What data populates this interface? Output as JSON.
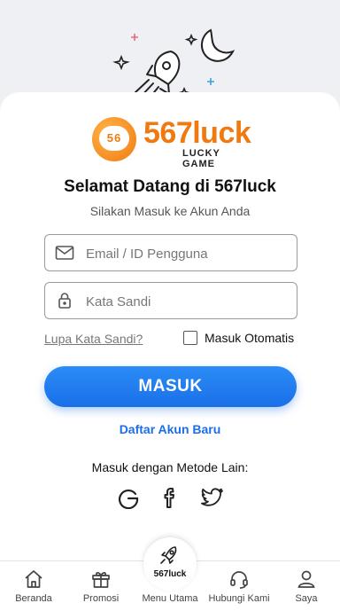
{
  "brand": {
    "badge": "56",
    "name": "567luck",
    "tagline": "LUCKY GAME",
    "color": "#f07a10"
  },
  "login": {
    "title": "Selamat Datang di 567luck",
    "subtitle": "Silakan Masuk ke Akun Anda",
    "email_placeholder": "Email / ID Pengguna",
    "password_placeholder": "Kata Sandi",
    "forgot_label": "Lupa Kata Sandi?",
    "remember_label": "Masuk Otomatis",
    "remember_checked": false,
    "submit_label": "MASUK",
    "register_label": "Daftar Akun Baru",
    "other_methods_label": "Masuk dengan Metode Lain:",
    "social": [
      "google-icon",
      "facebook-icon",
      "twitter-icon"
    ],
    "accent": "#1a6fe8"
  },
  "nav": {
    "items": [
      {
        "label": "Beranda",
        "icon": "home-icon"
      },
      {
        "label": "Promosi",
        "icon": "gift-icon"
      },
      {
        "label": "Menu Utama",
        "icon": "rocket-icon",
        "brand": "567luck"
      },
      {
        "label": "Hubungi Kami",
        "icon": "headset-icon"
      },
      {
        "label": "Saya",
        "icon": "user-icon"
      }
    ]
  }
}
